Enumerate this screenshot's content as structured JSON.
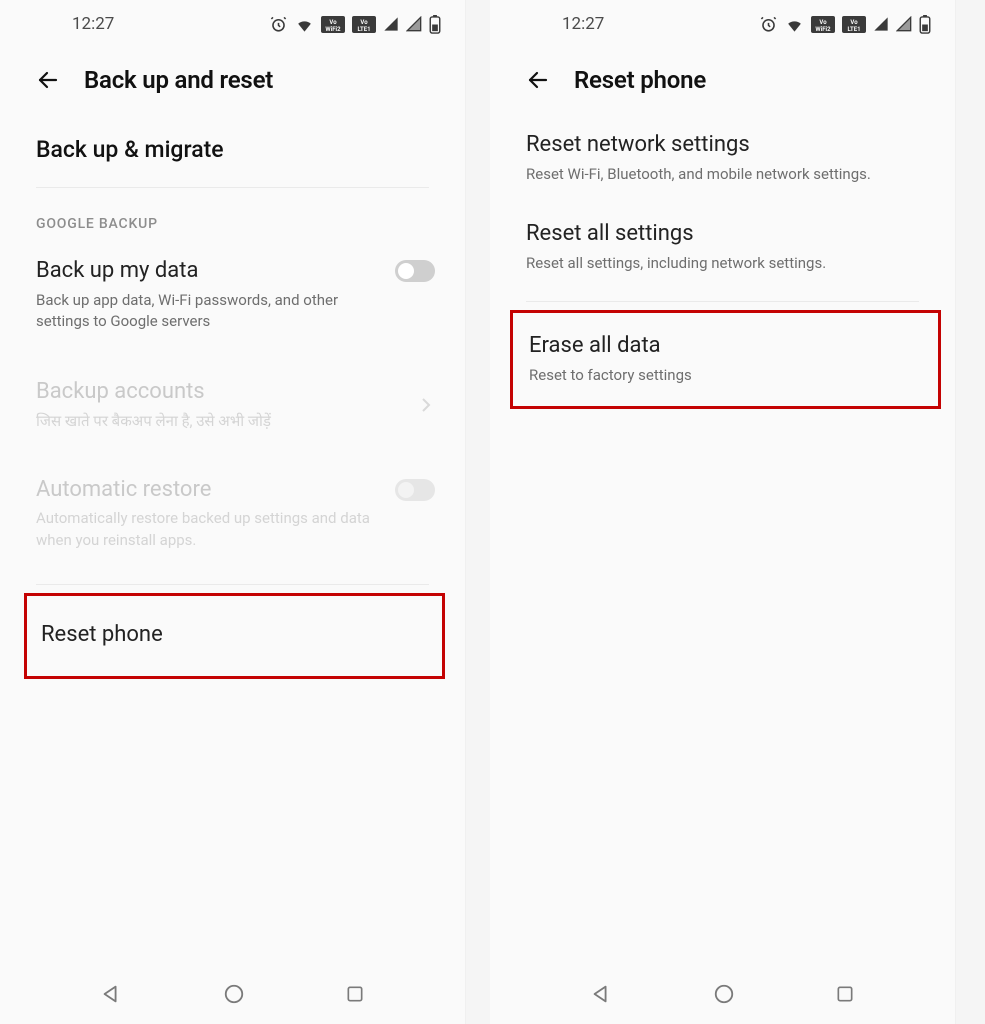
{
  "statusbar": {
    "time": "12:27"
  },
  "screen1": {
    "header_title": "Back up and reset",
    "backup_migrate": "Back up & migrate",
    "google_backup_label": "GOOGLE BACKUP",
    "backup_data": {
      "title": "Back up my data",
      "desc": "Back up app data, Wi-Fi passwords, and other settings to Google servers"
    },
    "backup_accounts": {
      "title": "Backup accounts",
      "desc": "जिस खाते पर बैकअप लेना है, उसे अभी जोड़ें"
    },
    "auto_restore": {
      "title": "Automatic restore",
      "desc": "Automatically restore backed up settings and data when you reinstall apps."
    },
    "reset_phone": "Reset phone"
  },
  "screen2": {
    "header_title": "Reset phone",
    "reset_network": {
      "title": "Reset network settings",
      "desc": "Reset Wi-Fi, Bluetooth, and mobile network settings."
    },
    "reset_all": {
      "title": "Reset all settings",
      "desc": "Reset all settings, including network settings."
    },
    "erase_all": {
      "title": "Erase all data",
      "desc": "Reset to factory settings"
    }
  }
}
